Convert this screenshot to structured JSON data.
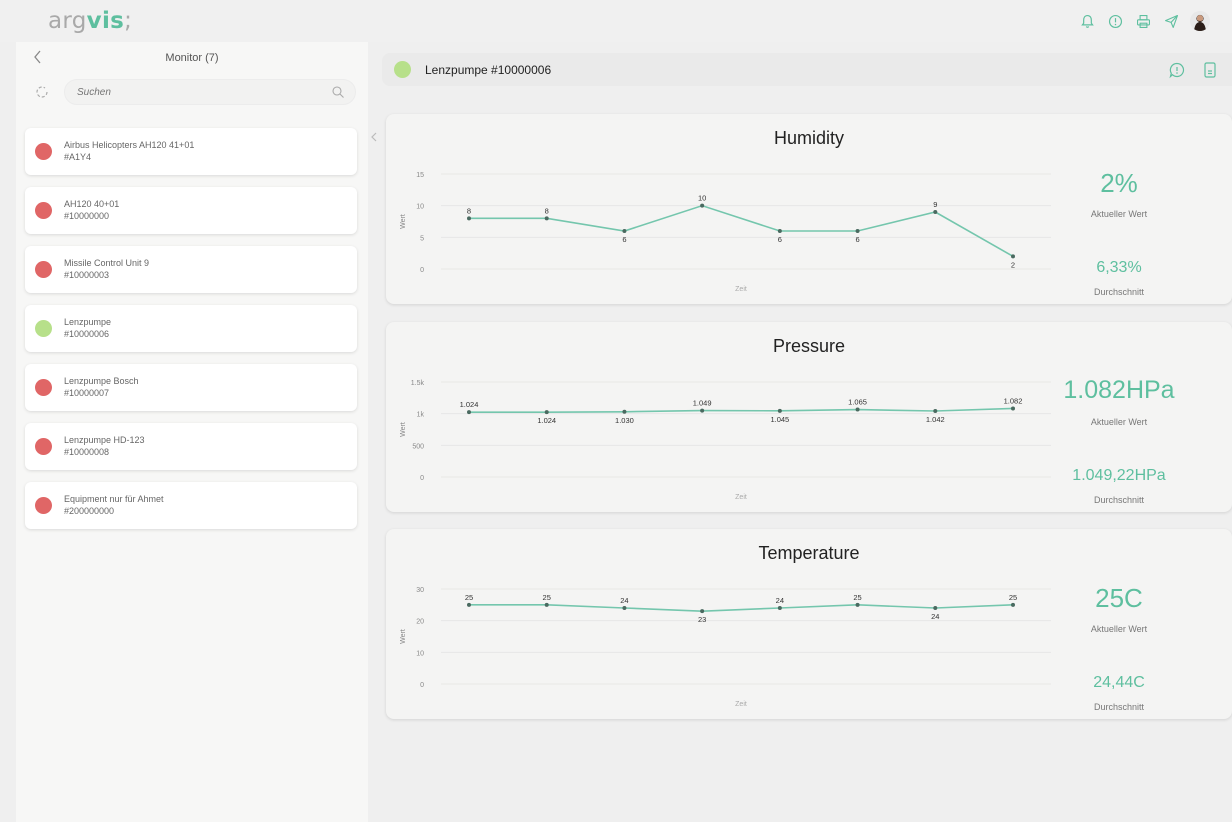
{
  "app": {
    "logo_a": "arg",
    "logo_b": "vis",
    "logo_c": ";"
  },
  "topbar": {
    "icons": [
      "bell-icon",
      "alert-circle-icon",
      "printer-icon",
      "send-icon",
      "user-avatar"
    ]
  },
  "sidebar": {
    "title": "Monitor (7)",
    "search_placeholder": "Suchen",
    "items": [
      {
        "name": "Airbus Helicopters AH120 41+01",
        "id": "#A1Y4",
        "status": "red"
      },
      {
        "name": "AH120 40+01",
        "id": "#10000000",
        "status": "red"
      },
      {
        "name": "Missile Control Unit 9",
        "id": "#10000003",
        "status": "red"
      },
      {
        "name": "Lenzpumpe",
        "id": "#10000006",
        "status": "green"
      },
      {
        "name": "Lenzpumpe Bosch",
        "id": "#10000007",
        "status": "red"
      },
      {
        "name": "Lenzpumpe HD-123",
        "id": "#10000008",
        "status": "red"
      },
      {
        "name": "Equipment nur für Ahmet",
        "id": "#200000000",
        "status": "red"
      }
    ]
  },
  "colors": {
    "red": "#e06666",
    "green": "#b7e08a",
    "accent": "#5ebf9f",
    "line": "#74c6ad"
  },
  "main": {
    "title": "Lenzpumpe #10000006",
    "status": "green"
  },
  "chart_data": [
    {
      "type": "line",
      "title": "Humidity",
      "xlabel": "Zeit",
      "ylabel": "Wert",
      "yticks": [
        "15",
        "10",
        "5",
        "0"
      ],
      "ylim": [
        0,
        15
      ],
      "values": [
        8,
        8,
        6,
        10,
        6,
        6,
        9,
        2
      ],
      "value_labels": [
        "8",
        "8",
        "6",
        "10",
        "6",
        "6",
        "9",
        "2"
      ],
      "current_value": "2%",
      "current_label": "Aktueller Wert",
      "average_value": "6,33%",
      "average_label": "Durchschnitt"
    },
    {
      "type": "line",
      "title": "Pressure",
      "xlabel": "Zeit",
      "ylabel": "Wert",
      "yticks": [
        "1.5k",
        "1k",
        "500",
        "0"
      ],
      "ylim": [
        0,
        1500
      ],
      "values": [
        1024,
        1024,
        1030,
        1049,
        1045,
        1065,
        1042,
        1082
      ],
      "value_labels": [
        "1.024",
        "1.024",
        "1.030",
        "1.049",
        "1.045",
        "1.065",
        "1.042",
        "1.082"
      ],
      "current_value": "1.082HPa",
      "current_label": "Aktueller Wert",
      "average_value": "1.049,22HPa",
      "average_label": "Durchschnitt"
    },
    {
      "type": "line",
      "title": "Temperature",
      "xlabel": "Zeit",
      "ylabel": "Wert",
      "yticks": [
        "30",
        "20",
        "10",
        "0"
      ],
      "ylim": [
        0,
        30
      ],
      "values": [
        25,
        25,
        24,
        23,
        24,
        25,
        24,
        25
      ],
      "value_labels": [
        "25",
        "25",
        "24",
        "23",
        "24",
        "25",
        "24",
        "25"
      ],
      "current_value": "25C",
      "current_label": "Aktueller Wert",
      "average_value": "24,44C",
      "average_label": "Durchschnitt"
    }
  ]
}
